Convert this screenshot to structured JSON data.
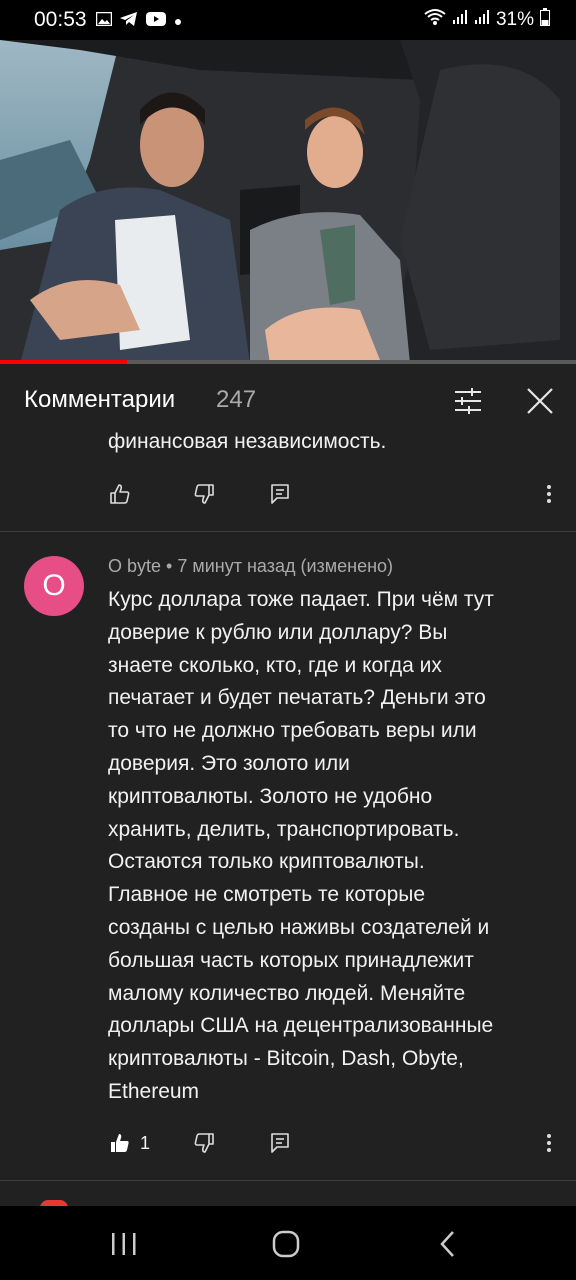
{
  "status_bar": {
    "time": "00:53",
    "battery": "31%",
    "icons": [
      "gallery-icon",
      "telegram-icon",
      "youtube-icon",
      "dot-icon",
      "wifi-icon",
      "signal-icon",
      "signal-icon-2",
      "battery-icon"
    ]
  },
  "video": {
    "progress": 0.22
  },
  "comments_panel": {
    "title": "Комментарии",
    "count": "247"
  },
  "previous_comment": {
    "tail_text": "финансовая независимость."
  },
  "comment": {
    "avatar_letter": "O",
    "meta": "O byte • 7 минут назад (изменено)",
    "text": "Курс доллара тоже падает. При чём тут\nдоверие к рублю или доллару? Вы\nзнаете сколько, кто, где и когда их\nпечатает и будет печатать? Деньги это\nто что не должно требовать веры или\nдоверия. Это золото или\nкриптовалюты. Золото не удобно\nхранить, делить, транспортировать.\nОстаются только криптовалюты.\nГлавное не смотреть те которые\nсозданы с целью наживы создателей и\nбольшая часть которых принадлежит\nмалому количество людей. Меняйте\nдоллары США на децентрализованные\nкриптовалюты - Bitcoin, Dash, Obyte,\nEthereum",
    "likes": "1"
  },
  "colors": {
    "accent": "#ff0000",
    "avatar": "#e74e85",
    "background": "#212121"
  }
}
